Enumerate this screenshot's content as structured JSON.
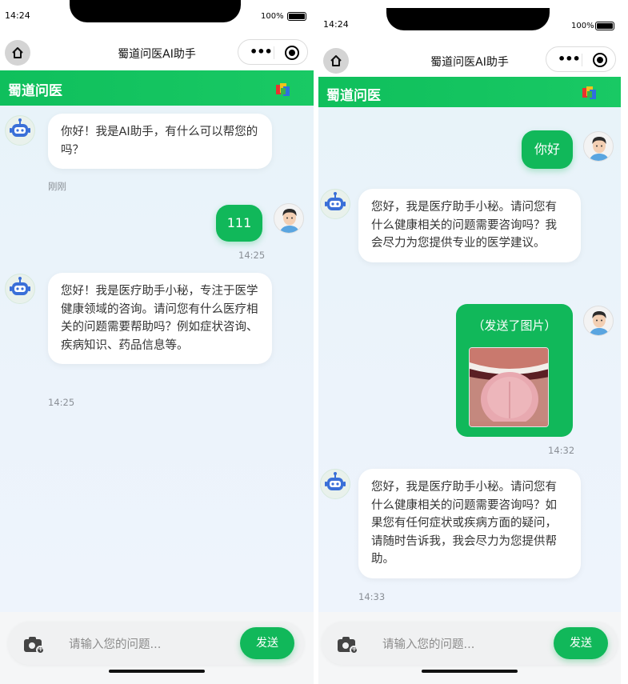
{
  "status": {
    "time": "14:24",
    "battery": "100%"
  },
  "nav": {
    "title": "蜀道问医AI助手"
  },
  "brand": "蜀道问医",
  "input": {
    "placeholder": "请输入您的问题...",
    "send_label": "发送"
  },
  "left_chat": {
    "msg1": {
      "text": "你好！我是AI助手，有什么可以帮您的吗？",
      "time": "刚刚"
    },
    "msg2": {
      "text": "111",
      "time": "14:25"
    },
    "msg3": {
      "text": "您好！我是医疗助手小秘，专注于医学健康领域的咨询。请问您有什么医疗相关的问题需要帮助吗？例如症状咨询、疾病知识、药品信息等。",
      "time": "14:25"
    }
  },
  "right_chat": {
    "msg1": {
      "text": "你好"
    },
    "msg2": {
      "text": "您好，我是医疗助手小秘。请问您有什么健康相关的问题需要咨询吗？我会尽力为您提供专业的医学建议。"
    },
    "msg3": {
      "caption": "（发送了图片）",
      "time": "14:32"
    },
    "msg4": {
      "text": "您好，我是医疗助手小秘。请问您有什么健康相关的问题需要咨询吗？如果您有任何症状或疾病方面的疑问，请随时告诉我，我会尽力为您提供帮助。",
      "time": "14:33"
    }
  },
  "colors": {
    "accent": "#11b85a",
    "chat_bg": "#eaf3fa"
  }
}
